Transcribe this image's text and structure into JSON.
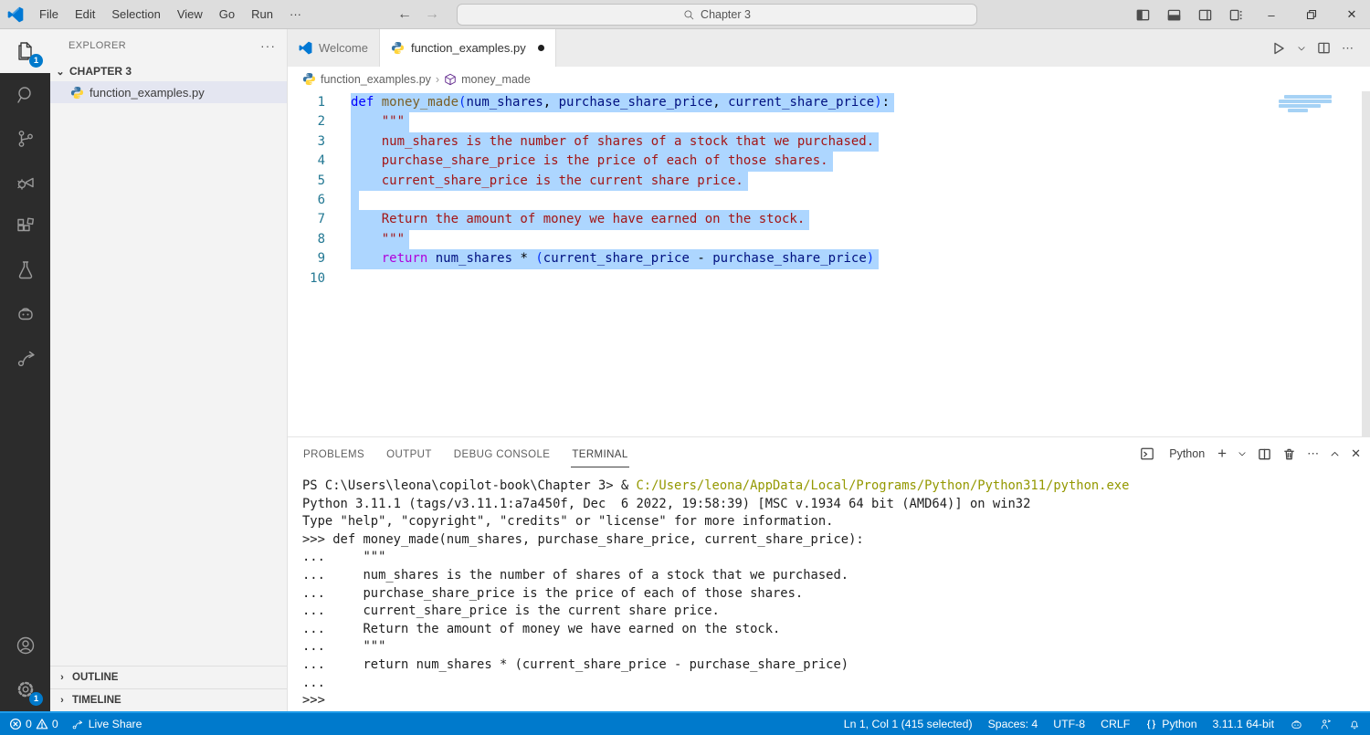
{
  "titlebar": {
    "menus": [
      "File",
      "Edit",
      "Selection",
      "View",
      "Go",
      "Run",
      "···"
    ],
    "search_value": "Chapter 3"
  },
  "activity_bar": {
    "explorer_badge": "1",
    "settings_badge": "1",
    "items": [
      "explorer",
      "search",
      "source-control",
      "run-and-debug",
      "extensions",
      "testing",
      "copilot",
      "live-share"
    ],
    "bottom_items": [
      "account",
      "settings"
    ]
  },
  "sidebar": {
    "title": "EXPLORER",
    "actions": "···",
    "folder": "CHAPTER 3",
    "file": "function_examples.py",
    "outline": "OUTLINE",
    "timeline": "TIMELINE"
  },
  "tabs": [
    {
      "label": "Welcome",
      "icon": "vscode",
      "active": false,
      "modified": false
    },
    {
      "label": "function_examples.py",
      "icon": "python",
      "active": true,
      "modified": true
    }
  ],
  "breadcrumbs": {
    "file": "function_examples.py",
    "symbol": "money_made"
  },
  "editor": {
    "token_colors": {
      "kw": "#0000FF",
      "fn": "#795E26",
      "pm": "#001080",
      "st": "#A31515",
      "ct": "#AF00DB",
      "br": "#0431FA",
      "pl": "#000000"
    },
    "selection_color": "#ADD6FF",
    "lines": [
      {
        "n": "1",
        "sel": true,
        "tokens": [
          [
            "def",
            "kw"
          ],
          [
            " ",
            "pl"
          ],
          [
            "money_made",
            "fn"
          ],
          [
            "(",
            "br"
          ],
          [
            "num_shares",
            "pm"
          ],
          [
            ", ",
            "pl"
          ],
          [
            "purchase_share_price",
            "pm"
          ],
          [
            ", ",
            "pl"
          ],
          [
            "current_share_price",
            "pm"
          ],
          [
            ")",
            "br"
          ],
          [
            ":",
            "pl"
          ]
        ]
      },
      {
        "n": "2",
        "sel": true,
        "tokens": [
          [
            "    ",
            "pl"
          ],
          [
            "\"\"\"",
            "st"
          ]
        ]
      },
      {
        "n": "3",
        "sel": true,
        "tokens": [
          [
            "    num_shares is the number of shares of a stock that we purchased.",
            "st"
          ]
        ]
      },
      {
        "n": "4",
        "sel": true,
        "tokens": [
          [
            "    purchase_share_price is the price of each of those shares.",
            "st"
          ]
        ]
      },
      {
        "n": "5",
        "sel": true,
        "tokens": [
          [
            "    current_share_price is the current share price.",
            "st"
          ]
        ]
      },
      {
        "n": "6",
        "sel": true,
        "tokens": []
      },
      {
        "n": "7",
        "sel": true,
        "tokens": [
          [
            "    Return the amount of money we have earned on the stock.",
            "st"
          ]
        ]
      },
      {
        "n": "8",
        "sel": true,
        "tokens": [
          [
            "    \"\"\"",
            "st"
          ]
        ]
      },
      {
        "n": "9",
        "sel": true,
        "tokens": [
          [
            "    ",
            "pl"
          ],
          [
            "return",
            "ct"
          ],
          [
            " ",
            "pl"
          ],
          [
            "num_shares",
            "pm"
          ],
          [
            " * ",
            "pl"
          ],
          [
            "(",
            "br"
          ],
          [
            "current_share_price",
            "pm"
          ],
          [
            " - ",
            "pl"
          ],
          [
            "purchase_share_price",
            "pm"
          ],
          [
            ")",
            "br"
          ]
        ]
      },
      {
        "n": "10",
        "sel": false,
        "tokens": []
      }
    ]
  },
  "panel": {
    "tabs": [
      "PROBLEMS",
      "OUTPUT",
      "DEBUG CONSOLE",
      "TERMINAL"
    ],
    "active_tab": "TERMINAL",
    "shell_label": "Python",
    "terminal_colors": {
      "pl": "#1f1f1f",
      "path": "#949800"
    },
    "terminal_lines": [
      [
        [
          "PS C:\\Users\\leona\\copilot-book\\Chapter 3> & ",
          "pl"
        ],
        [
          "C:/Users/leona/AppData/Local/Programs/Python/Python311/python.exe",
          "path"
        ]
      ],
      [
        [
          "Python 3.11.1 (tags/v3.11.1:a7a450f, Dec  6 2022, 19:58:39) [MSC v.1934 64 bit (AMD64)] on win32",
          "pl"
        ]
      ],
      [
        [
          "Type \"help\", \"copyright\", \"credits\" or \"license\" for more information.",
          "pl"
        ]
      ],
      [
        [
          ">>> def money_made(num_shares, purchase_share_price, current_share_price):",
          "pl"
        ]
      ],
      [
        [
          "...     \"\"\"",
          "pl"
        ]
      ],
      [
        [
          "...     num_shares is the number of shares of a stock that we purchased.",
          "pl"
        ]
      ],
      [
        [
          "...     purchase_share_price is the price of each of those shares.",
          "pl"
        ]
      ],
      [
        [
          "...     current_share_price is the current share price.",
          "pl"
        ]
      ],
      [
        [
          "...     Return the amount of money we have earned on the stock.",
          "pl"
        ]
      ],
      [
        [
          "...     \"\"\"",
          "pl"
        ]
      ],
      [
        [
          "...     return num_shares * (current_share_price - purchase_share_price)",
          "pl"
        ]
      ],
      [
        [
          "...",
          "pl"
        ]
      ],
      [
        [
          ">>>",
          "pl"
        ]
      ]
    ]
  },
  "status_bar": {
    "accent_color": "#007ACC",
    "errors": "0",
    "warnings": "0",
    "live_share": "Live Share",
    "right_items": [
      {
        "name": "cursor-position",
        "label": "Ln 1, Col 1 (415 selected)"
      },
      {
        "name": "indentation",
        "label": "Spaces: 4"
      },
      {
        "name": "encoding",
        "label": "UTF-8"
      },
      {
        "name": "eol-sequence",
        "label": "CRLF"
      },
      {
        "name": "language-mode",
        "label": "Python",
        "icon": "braces"
      },
      {
        "name": "python-version",
        "label": "3.11.1 64-bit"
      }
    ]
  }
}
